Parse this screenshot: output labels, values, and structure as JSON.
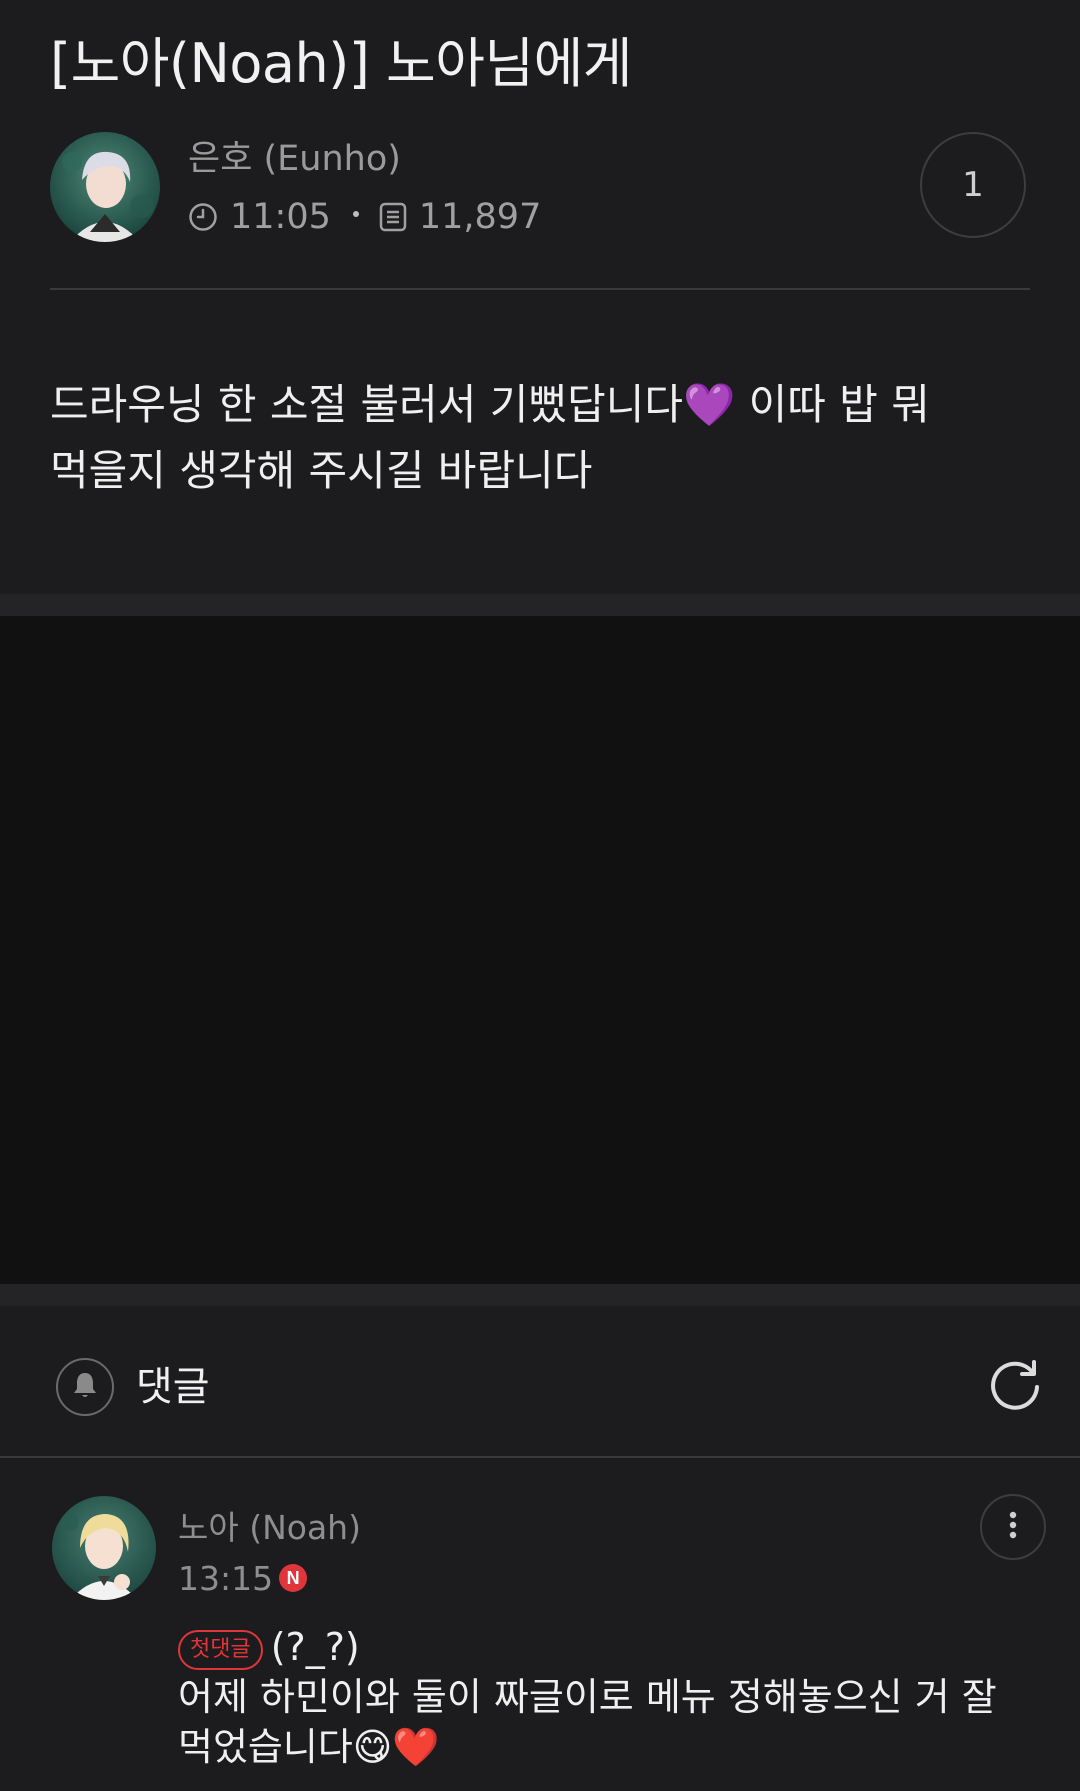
{
  "post": {
    "title": "[노아(Noah)] 노아님에게",
    "author": "은호 (Eunho)",
    "time": "11:05",
    "views": "11,897",
    "comment_count": "1",
    "body": "드라우닝 한 소절 불러서 기뻤답니다💜 이따 밥 뭐 먹을지 생각해 주시길 바랍니다"
  },
  "comments_section": {
    "label": "댓글"
  },
  "comments": [
    {
      "author": "노아 (Noah)",
      "time": "13:15",
      "new_badge": "N",
      "first_badge": "첫댓글",
      "first_line": "(?_?)",
      "body": "어제 하민이와 둘이 짜글이로 메뉴 정해놓으신 거 잘 먹었습니다😋❤️"
    }
  ],
  "icons": {
    "clock": "clock-icon",
    "views": "document-list-icon",
    "bell": "bell-icon",
    "refresh": "refresh-icon",
    "more": "more-vertical-icon"
  },
  "colors": {
    "background": "#1c1c1e",
    "media_background": "#111111",
    "accent_red": "#e0353b",
    "muted_text": "#9a9a9a",
    "primary_text": "#efefef"
  }
}
